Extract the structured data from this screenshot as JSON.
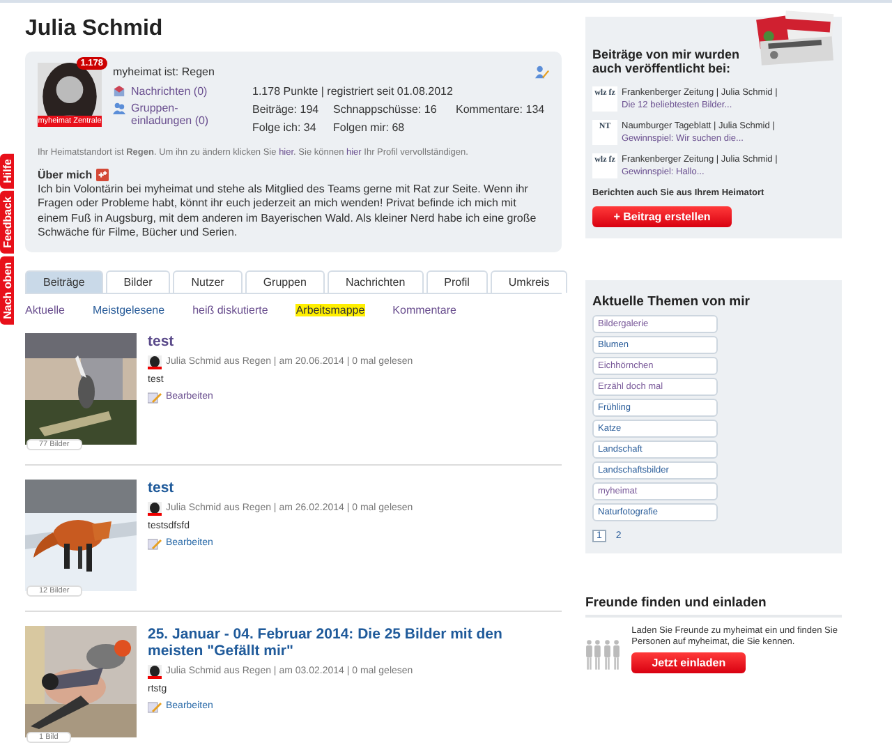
{
  "side_tabs": [
    "Hilfe",
    "Feedback",
    "Nach oben"
  ],
  "profile": {
    "name": "Julia Schmid",
    "points_badge": "1.178",
    "avatar_caption": "myheimat Zentrale",
    "home": "myheimat ist: Regen",
    "messages_link": "Nachrichten (0)",
    "groups_link": "Gruppen-einladungen (0)",
    "stats_line": "1.178 Punkte | registriert seit 01.08.2012",
    "stats": [
      "Beiträge: 194",
      "Schnappschüsse: 16",
      "Kommentare: 134",
      "Folge ich: 34",
      "Folgen mir: 68"
    ],
    "hint": {
      "before": "Ihr Heimatstandort ist **Regen**. Um ihn zu ändern klicken Sie",
      "link1": "hier",
      "middle": ". Sie können",
      "link2": "hier",
      "after": "Ihr Profil vervollständigen."
    },
    "about_title": "Über mich",
    "about_text": "Ich bin Volontärin bei myheimat und stehe als Mitglied des Teams gerne mit Rat zur Seite. Wenn ihr Fragen oder Probleme habt, könnt ihr euch jederzeit an mich wenden! Privat befinde ich mich mit einem Fuß in Augsburg, mit dem anderen im Bayerischen Wald. Als kleiner Nerd habe ich eine große Schwäche für Filme, Bücher und Serien."
  },
  "tabs": [
    {
      "label": "Beiträge",
      "selected": true
    },
    {
      "label": "Bilder",
      "selected": false
    },
    {
      "label": "Nutzer",
      "selected": false
    },
    {
      "label": "Gruppen",
      "selected": false
    },
    {
      "label": "Nachrichten",
      "selected": false
    },
    {
      "label": "Profil",
      "selected": false
    },
    {
      "label": "Umkreis",
      "selected": false
    }
  ],
  "subtabs": [
    {
      "label": "Aktuelle",
      "highlighted": false,
      "visited": true
    },
    {
      "label": "Meistgelesene",
      "highlighted": false,
      "visited": false
    },
    {
      "label": "heiß diskutierte",
      "highlighted": false,
      "visited": true
    },
    {
      "label": "Arbeitsmappe",
      "highlighted": true,
      "visited": false
    },
    {
      "label": "Kommentare",
      "highlighted": false,
      "visited": true
    }
  ],
  "posts": [
    {
      "title": "test",
      "visited": true,
      "byline": "Julia Schmid aus Regen | am 20.06.2014 | 0 mal gelesen",
      "text": "test",
      "edit": "Bearbeiten",
      "count": "77 Bilder",
      "kind": "bird"
    },
    {
      "title": "test",
      "visited": false,
      "byline": "Julia Schmid aus Regen | am 26.02.2014 | 0 mal gelesen",
      "text": "testsdfsfd",
      "edit": "Bearbeiten",
      "count": "12 Bilder",
      "kind": "fox"
    },
    {
      "title": "25. Januar - 04. Februar 2014: Die 25 Bilder mit den meisten \"Gefällt mir\"",
      "visited": false,
      "byline": "Julia Schmid aus Regen | am 03.02.2014 | 0 mal gelesen",
      "text": "rtstg",
      "edit": "Bearbeiten",
      "count": "1 Bild",
      "kind": "finch"
    }
  ],
  "published": {
    "title": "Beiträge von mir wurden auch veröffentlicht bei:",
    "items": [
      {
        "logo": "wlz fz",
        "source": "Frankenberger Zeitung | Julia Schmid |",
        "link": "Die 12 beliebtesten Bilder..."
      },
      {
        "logo": "NT",
        "source": "Naumburger Tageblatt | Julia Schmid |",
        "link": "Gewinnspiel: Wir suchen die..."
      },
      {
        "logo": "wlz fz",
        "source": "Frankenberger Zeitung | Julia Schmid |",
        "link": "Gewinnspiel: Hallo..."
      }
    ],
    "cta": "Berichten auch Sie aus Ihrem Heimatort",
    "button": "+ Beitrag erstellen"
  },
  "topics": {
    "title": "Aktuelle Themen von mir",
    "tags": [
      {
        "label": "Bildergalerie",
        "visited": true
      },
      {
        "label": "Blumen",
        "visited": false
      },
      {
        "label": "Eichhörnchen",
        "visited": true
      },
      {
        "label": "Erzähl doch mal",
        "visited": true
      },
      {
        "label": "Frühling",
        "visited": false
      },
      {
        "label": "Katze",
        "visited": false
      },
      {
        "label": "Landschaft",
        "visited": false
      },
      {
        "label": "Landschaftsbilder",
        "visited": false
      },
      {
        "label": "myheimat",
        "visited": true
      },
      {
        "label": "Naturfotografie",
        "visited": false
      }
    ],
    "pages": [
      {
        "label": "1",
        "selected": true
      },
      {
        "label": "2",
        "selected": false
      }
    ]
  },
  "friends": {
    "title": "Freunde finden und einladen",
    "text": "Laden Sie Freunde zu myheimat ein und finden Sie Personen auf myheimat, die Sie kennen.",
    "button": "Jetzt einladen"
  }
}
